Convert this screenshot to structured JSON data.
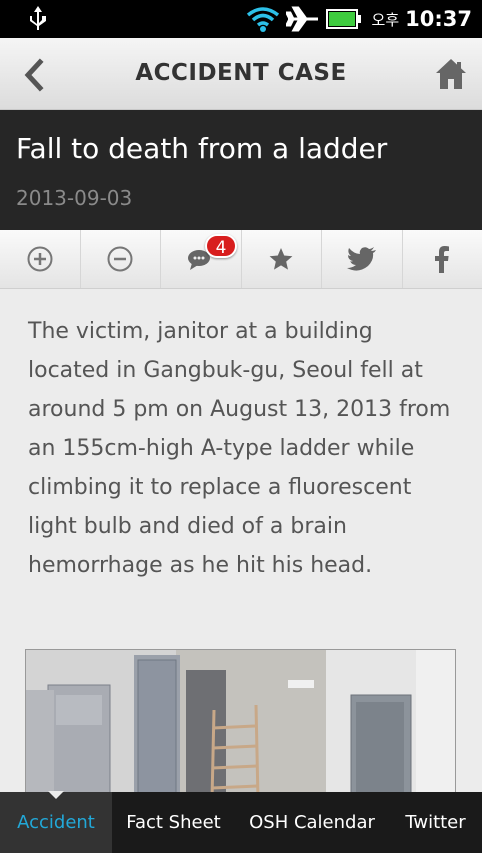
{
  "status_bar": {
    "ampm": "오후",
    "time": "10:37",
    "icons": [
      "usb-icon",
      "wifi-icon",
      "airplane-icon",
      "battery-icon"
    ]
  },
  "header": {
    "title": "ACCIDENT CASE",
    "back_icon": "chevron-left-icon",
    "home_icon": "home-icon"
  },
  "article": {
    "title": "Fall to death from a ladder",
    "date": "2013-09-03",
    "body": "The victim, janitor at a building located in Gangbuk-gu, Seoul fell at around 5 pm on August 13, 2013 from an 155cm-high A-type ladder while climbing it to replace a fluorescent light bulb and died of a brain hemorrhage as he hit his head."
  },
  "toolbar": {
    "items": [
      "zoom-in-icon",
      "zoom-out-icon",
      "comment-icon",
      "star-icon",
      "twitter-icon",
      "facebook-icon"
    ],
    "comment_count": "4"
  },
  "tabs": [
    {
      "label": "Accident",
      "active": true
    },
    {
      "label": "Fact Sheet",
      "active": false
    },
    {
      "label": "OSH Calendar",
      "active": false
    },
    {
      "label": "Twitter",
      "active": false
    }
  ],
  "colors": {
    "active_tab": "#22a8d8",
    "title_band": "#262626",
    "badge": "#d81e1e",
    "battery": "#3ecb3e"
  }
}
